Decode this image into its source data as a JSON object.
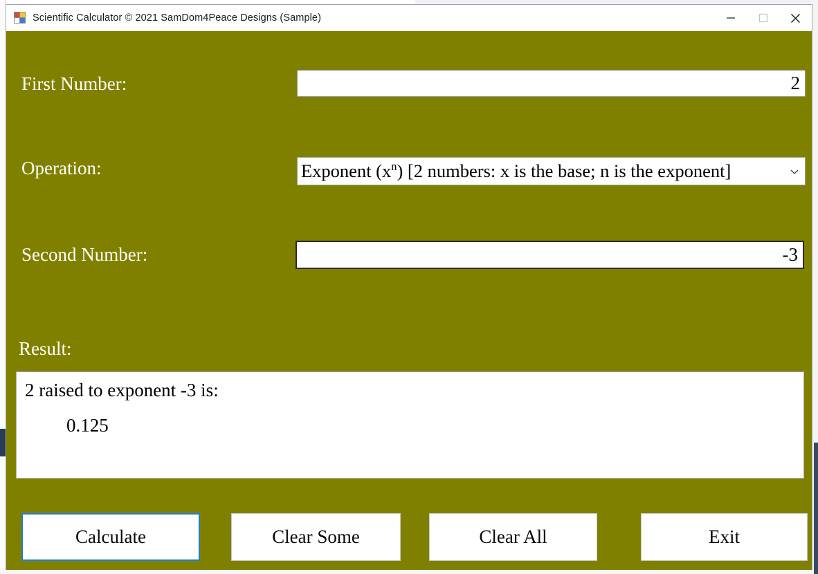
{
  "window": {
    "title": "Scientific Calculator © 2021 SamDom4Peace Designs (Sample)",
    "icon": "winforms-app-icon",
    "background_color": "#808000",
    "controls": {
      "minimize": "minimize-icon",
      "maximize": "maximize-icon",
      "close": "close-icon"
    }
  },
  "form": {
    "first_number": {
      "label": "First Number:",
      "value": "2",
      "placeholder": ""
    },
    "operation": {
      "label": "Operation:",
      "selected": "Exponent (xⁿ) [2 numbers: x is the base; n is the exponent]",
      "selected_prefix": "Exponent (x",
      "selected_superscript": "n",
      "selected_suffix": ") [2 numbers: x is the base; n is the exponent]",
      "arrow": "chevron-down-icon"
    },
    "second_number": {
      "label": "Second Number:",
      "value": "-3",
      "placeholder": ""
    },
    "result": {
      "label": "Result:",
      "line1": "2 raised to exponent -3 is:",
      "line2": "0.125"
    }
  },
  "buttons": {
    "calculate": "Calculate",
    "clear_some": "Clear Some",
    "clear_all": "Clear All",
    "exit": "Exit",
    "focus_color": "#1a7fd4"
  }
}
